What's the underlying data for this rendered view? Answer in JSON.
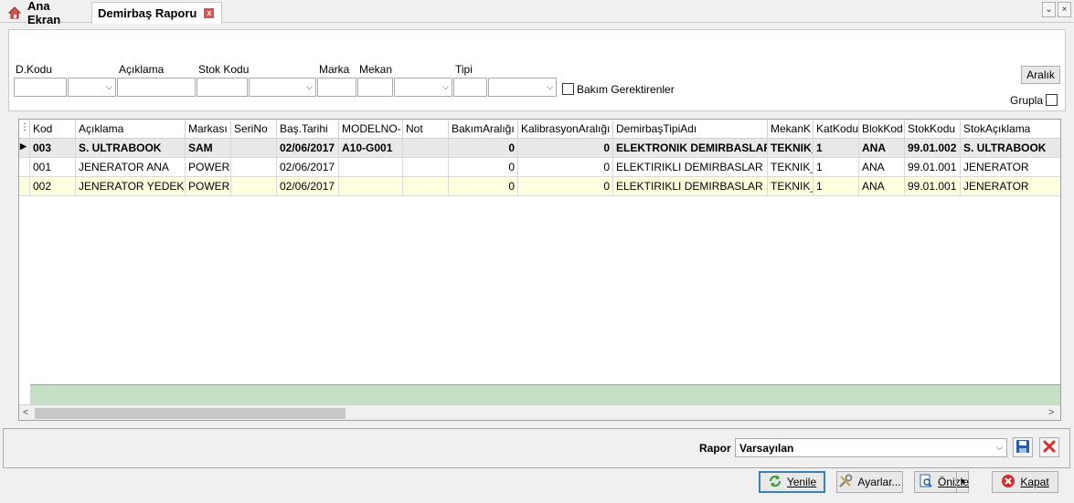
{
  "tabs": [
    {
      "label": "Ana Ekran"
    },
    {
      "label": "Demirbaş Raporu",
      "close": "x"
    }
  ],
  "window": {
    "dropdown_glyph": "⌄",
    "close_glyph": "×"
  },
  "filters": {
    "labels": {
      "dkodu": "D.Kodu",
      "aciklama": "Açıklama",
      "stokkodu": "Stok Kodu",
      "marka": "Marka",
      "mekan": "Mekan",
      "tipi": "Tipi"
    },
    "bakim_label": "Bakım Gerektirenler",
    "aralik_button": "Aralık",
    "grupla_label": "Grupla",
    "combo_arrow": "⌵"
  },
  "grid": {
    "columns": [
      "Kod",
      "Açıklama",
      "Markası",
      "SeriNo",
      "Baş.Tarihi",
      "MODELNO-",
      "Not",
      "BakımAralığı",
      "KalibrasyonAralığı",
      "DemirbaşTipiAdı",
      "MekanK",
      "KatKodu",
      "BlokKod",
      "StokKodu",
      "StokAçıklama"
    ],
    "rows": [
      {
        "kod": "003",
        "aciklama": "S. ULTRABOOK",
        "marka": "SAM",
        "serino": "",
        "tarih": "02/06/2017",
        "modelno": "A10-G001",
        "not": "",
        "bakim": "0",
        "kalibrasyon": "0",
        "tip": "ELEKTRONIK DEMIRBASLAR",
        "mekan": "TEKNIK_",
        "kat": "1",
        "blok": "ANA",
        "stokkodu": "99.01.002",
        "stokaciklama": "S. ULTRABOOK"
      },
      {
        "kod": "001",
        "aciklama": "JENERATOR ANA",
        "marka": "POWER",
        "serino": "",
        "tarih": "02/06/2017",
        "modelno": "",
        "not": "",
        "bakim": "0",
        "kalibrasyon": "0",
        "tip": "ELEKTIRIKLI DEMIRBASLAR",
        "mekan": "TEKNIK_",
        "kat": "1",
        "blok": "ANA",
        "stokkodu": "99.01.001",
        "stokaciklama": "JENERATOR"
      },
      {
        "kod": "002",
        "aciklama": "JENERATOR YEDEK",
        "marka": "POWER",
        "serino": "",
        "tarih": "02/06/2017",
        "modelno": "",
        "not": "",
        "bakim": "0",
        "kalibrasyon": "0",
        "tip": "ELEKTIRIKLI DEMIRBASLAR",
        "mekan": "TEKNIK_",
        "kat": "1",
        "blok": "ANA",
        "stokkodu": "99.01.001",
        "stokaciklama": "JENERATOR"
      }
    ],
    "scroll_left": "<",
    "scroll_right": ">"
  },
  "bottom": {
    "rapor_label": "Rapor",
    "rapor_value": "Varsayılan",
    "yenile": "Yenile",
    "ayarlar": "Ayarlar...",
    "onizle": "Önizle",
    "kapat": "Kapat"
  },
  "colors": {
    "accent": "#3c7fb1",
    "grid_footer": "#c6e0c6",
    "alt_row": "#ffffe0",
    "close_red": "#d9534f"
  }
}
